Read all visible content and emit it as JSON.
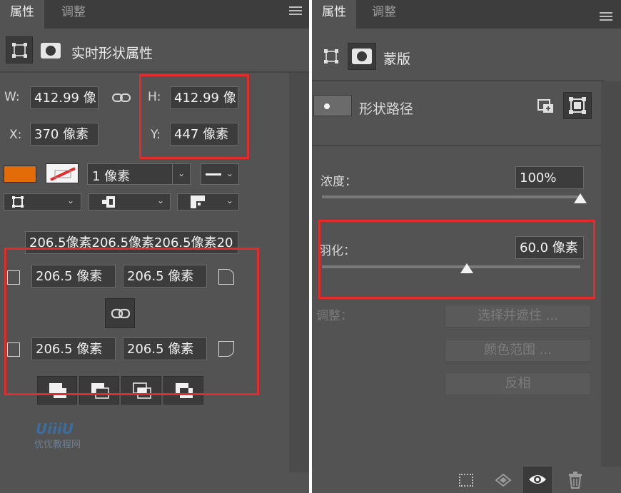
{
  "left_panel": {
    "tabs": [
      {
        "label": "属性",
        "active": true
      },
      {
        "label": "调整",
        "active": false
      }
    ],
    "header_title": "实时形状属性",
    "w_label": "W:",
    "w_value": "412.99 像",
    "h_label": "H:",
    "h_value": "412.99 像",
    "x_label": "X:",
    "x_value": "370 像素",
    "y_label": "Y:",
    "y_value": "447 像素",
    "fill_color": "#e36c09",
    "stroke_width": "1 像素",
    "radius_all": "206.5像素206.5像素206.5像素20",
    "radius_tl": "206.5 像素",
    "radius_tr": "206.5 像素",
    "radius_bl": "206.5 像素",
    "radius_br": "206.5 像素",
    "watermark_text": "优优教程网"
  },
  "right_panel": {
    "tabs": [
      {
        "label": "属性",
        "active": true
      },
      {
        "label": "调整",
        "active": false
      }
    ],
    "header_title": "蒙版",
    "shape_path_label": "形状路径",
    "density_label": "浓度：",
    "density_value": "100%",
    "density_level": 1.0,
    "feather_label": "羽化：",
    "feather_value": "60.0 像素",
    "feather_level": 0.56,
    "adjust_label": "调整：",
    "select_mask_button": "选择并遮住 ...",
    "color_range_button": "颜色范围 ...",
    "invert_button": "反相"
  },
  "highlight_color": "#e32b2b"
}
